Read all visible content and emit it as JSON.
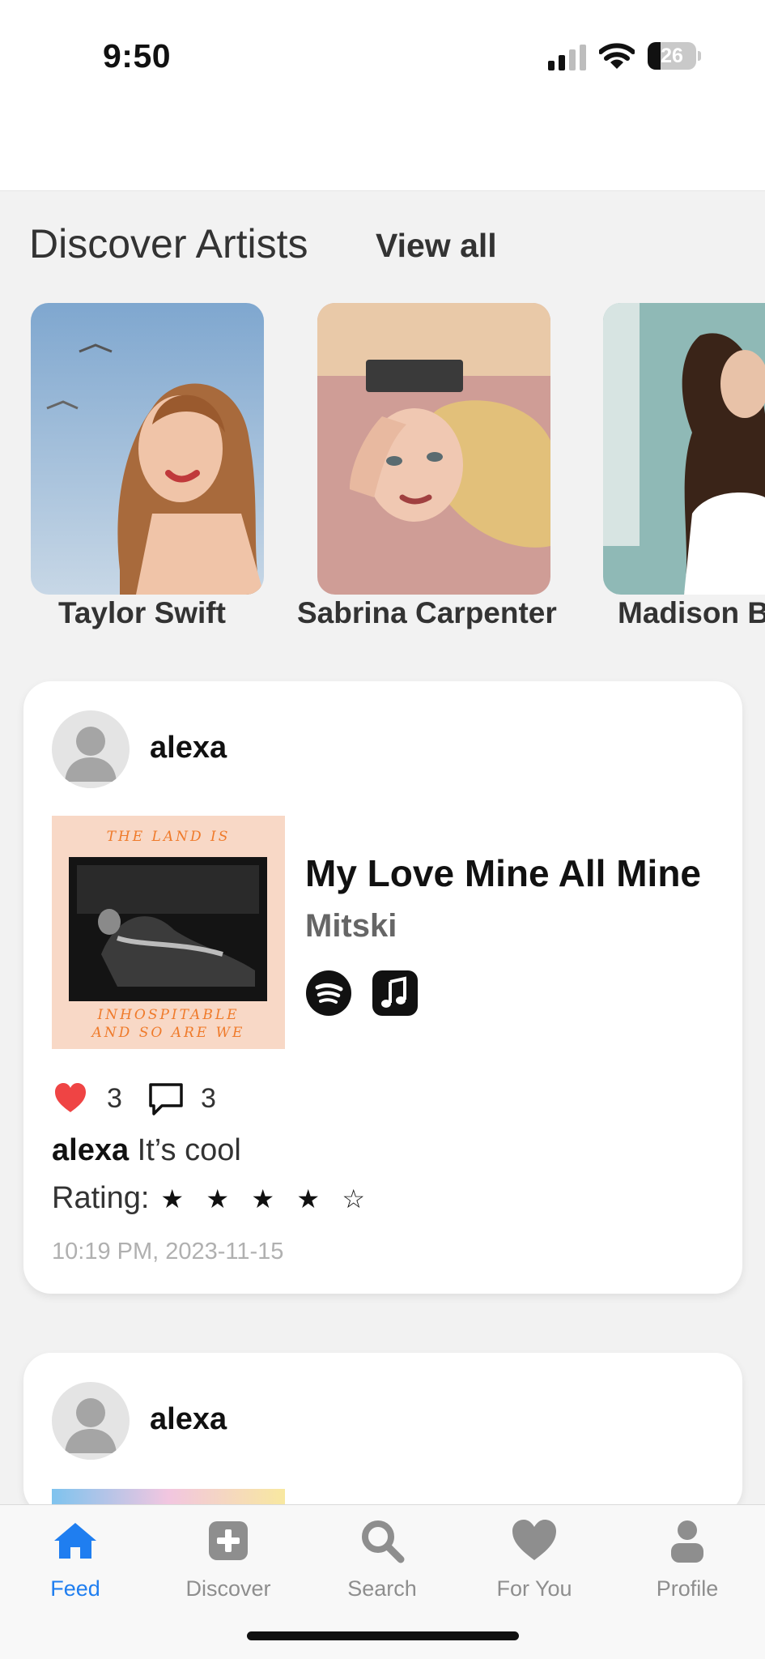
{
  "status_bar": {
    "time": "9:50",
    "battery_level": "26"
  },
  "discover": {
    "title": "Discover Artists",
    "view_all": "View all",
    "artists": [
      {
        "name": "Taylor Swift"
      },
      {
        "name": "Sabrina Carpenter"
      },
      {
        "name": "Madison Beer",
        "name_visible": "Madison B"
      }
    ]
  },
  "posts": [
    {
      "username": "alexa",
      "song_title": "My Love Mine All Mine",
      "song_artist": "Mitski",
      "likes": "3",
      "comments": "3",
      "caption_user": "alexa",
      "caption_text": "It’s cool",
      "rating_label": "Rating:",
      "rating_stars": [
        "★",
        "★",
        "★",
        "★",
        "☆"
      ],
      "rating_value": 4,
      "timestamp": "10:19 PM, 2023-11-15"
    },
    {
      "username": "alexa"
    }
  ],
  "tabbar": {
    "tabs": [
      {
        "label": "Feed",
        "icon": "house-icon",
        "active": true
      },
      {
        "label": "Discover",
        "icon": "plus-square-icon"
      },
      {
        "label": "Search",
        "icon": "magnifier-icon"
      },
      {
        "label": "For You",
        "icon": "heart-icon"
      },
      {
        "label": "Profile",
        "icon": "person-icon"
      }
    ]
  },
  "colors": {
    "accent": "#1f7ef0",
    "like": "#ef4444",
    "background": "#f2f2f2"
  }
}
